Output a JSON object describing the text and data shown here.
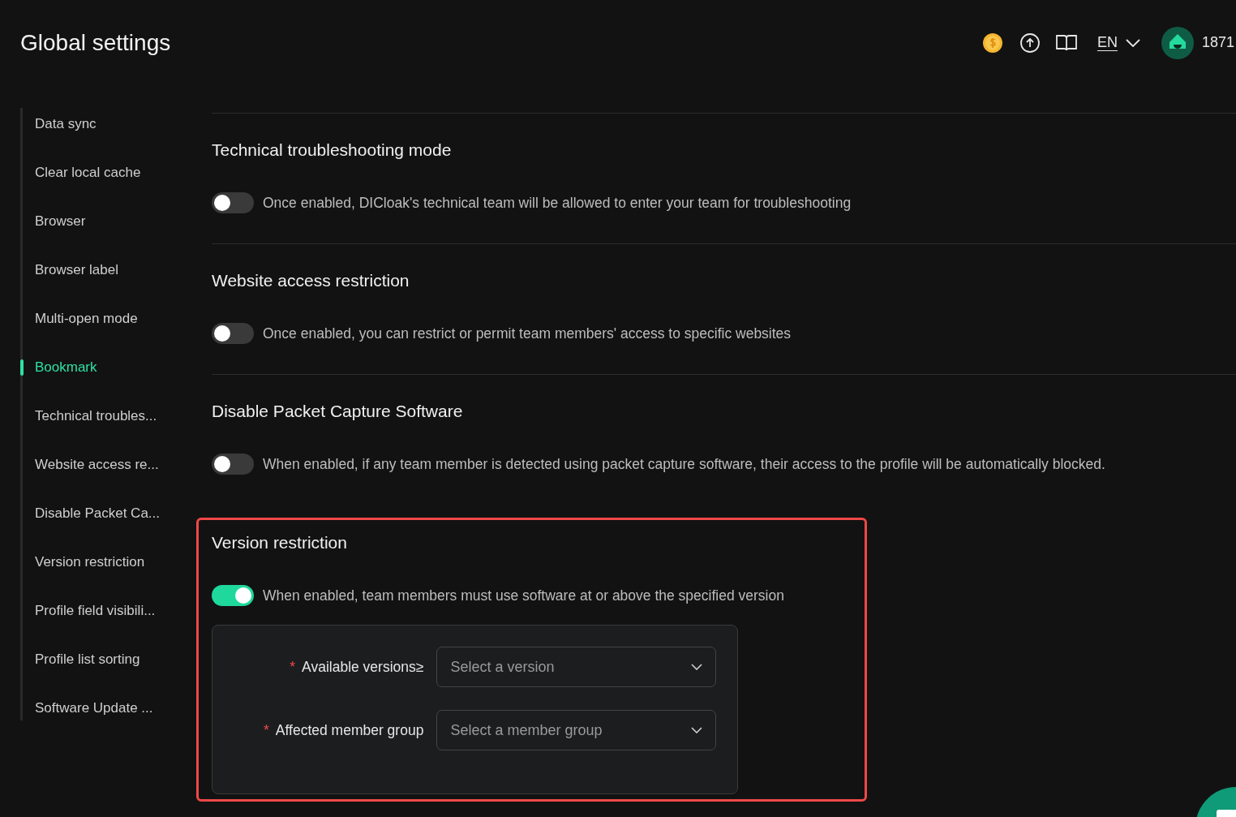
{
  "header": {
    "title": "Global settings",
    "language": "EN",
    "account": "1871"
  },
  "sidebar": {
    "items": [
      {
        "label": "Data sync",
        "selected": false
      },
      {
        "label": "Clear local cache",
        "selected": false
      },
      {
        "label": "Browser",
        "selected": false
      },
      {
        "label": "Browser label",
        "selected": false
      },
      {
        "label": "Multi-open mode",
        "selected": false
      },
      {
        "label": "Bookmark",
        "selected": true
      },
      {
        "label": "Technical troubles...",
        "selected": false
      },
      {
        "label": "Website access re...",
        "selected": false
      },
      {
        "label": "Disable Packet Ca...",
        "selected": false
      },
      {
        "label": "Version restriction",
        "selected": false
      },
      {
        "label": "Profile field visibili...",
        "selected": false
      },
      {
        "label": "Profile list sorting",
        "selected": false
      },
      {
        "label": "Software Update ...",
        "selected": false
      }
    ]
  },
  "sections": [
    {
      "title": "Technical troubleshooting mode",
      "description": "Once enabled, DICloak's technical team will be allowed to enter your team for troubleshooting",
      "on": false,
      "highlighted": false
    },
    {
      "title": "Website access restriction",
      "description": "Once enabled, you can restrict or permit team members' access to specific websites",
      "on": false,
      "highlighted": false
    },
    {
      "title": "Disable Packet Capture Software",
      "description": "When enabled, if any team member is detected using packet capture software, their access to the profile will be automatically blocked.",
      "on": false,
      "highlighted": false
    },
    {
      "title": "Version restriction",
      "description": "When enabled, team members must use software at or above the specified version",
      "on": true,
      "highlighted": true,
      "fields": [
        {
          "label": "Available versions≥",
          "required": "*",
          "placeholder": "Select a version"
        },
        {
          "label": "Affected member group",
          "required": "*",
          "placeholder": "Select a member group"
        }
      ]
    }
  ]
}
